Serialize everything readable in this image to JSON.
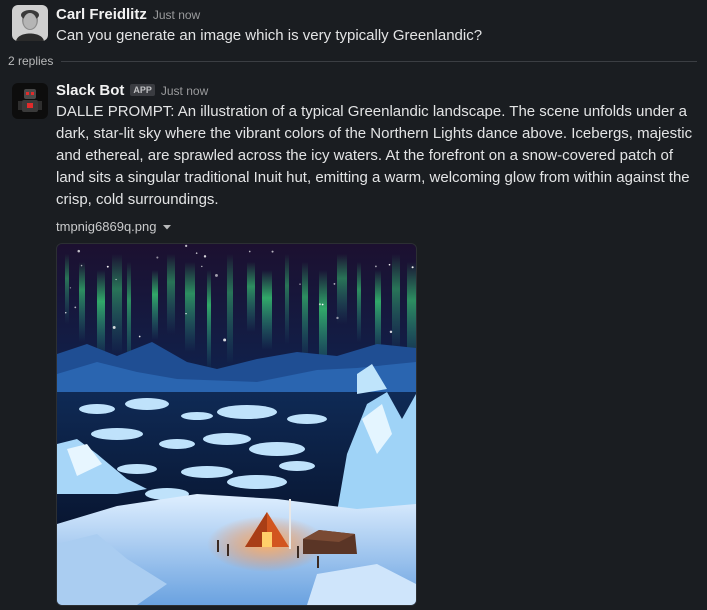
{
  "message1": {
    "sender": "Carl Freidlitz",
    "time": "Just now",
    "text": "Can you generate an image which is very typically Greenlandic?"
  },
  "thread": {
    "replies_label": "2 replies"
  },
  "message2": {
    "sender": "Slack Bot",
    "badge": "APP",
    "time": "Just now",
    "text": "DALLE PROMPT: An illustration of a typical Greenlandic landscape. The scene unfolds under a dark, star-lit sky where the vibrant colors of the Northern Lights dance above. Icebergs, majestic and ethereal, are sprawled across the icy waters. At the forefront on a snow-covered patch of land sits a singular traditional Inuit hut, emitting a warm, welcoming glow from within against the crisp, cold surroundings.",
    "file_name": "tmpnig6869q.png"
  },
  "colors": {
    "background": "#1a1d21",
    "text": "#d1d2d3",
    "aurora": "#3be07a",
    "glow": "#ff7a2a"
  }
}
